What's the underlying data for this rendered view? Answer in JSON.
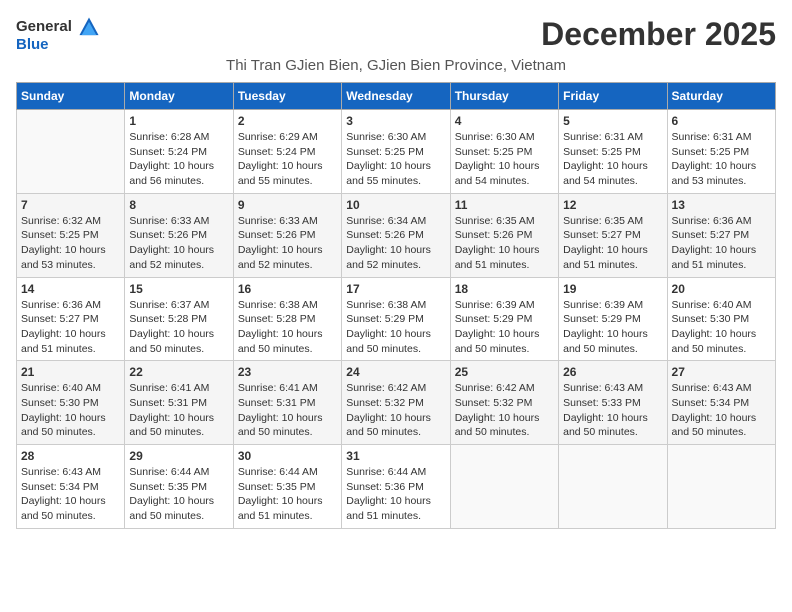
{
  "header": {
    "logo_general": "General",
    "logo_blue": "Blue",
    "month_title": "December 2025",
    "location": "Thi Tran GJien Bien, GJien Bien Province, Vietnam"
  },
  "days_of_week": [
    "Sunday",
    "Monday",
    "Tuesday",
    "Wednesday",
    "Thursday",
    "Friday",
    "Saturday"
  ],
  "weeks": [
    [
      {
        "day": "",
        "info": ""
      },
      {
        "day": "1",
        "info": "Sunrise: 6:28 AM\nSunset: 5:24 PM\nDaylight: 10 hours\nand 56 minutes."
      },
      {
        "day": "2",
        "info": "Sunrise: 6:29 AM\nSunset: 5:24 PM\nDaylight: 10 hours\nand 55 minutes."
      },
      {
        "day": "3",
        "info": "Sunrise: 6:30 AM\nSunset: 5:25 PM\nDaylight: 10 hours\nand 55 minutes."
      },
      {
        "day": "4",
        "info": "Sunrise: 6:30 AM\nSunset: 5:25 PM\nDaylight: 10 hours\nand 54 minutes."
      },
      {
        "day": "5",
        "info": "Sunrise: 6:31 AM\nSunset: 5:25 PM\nDaylight: 10 hours\nand 54 minutes."
      },
      {
        "day": "6",
        "info": "Sunrise: 6:31 AM\nSunset: 5:25 PM\nDaylight: 10 hours\nand 53 minutes."
      }
    ],
    [
      {
        "day": "7",
        "info": "Sunrise: 6:32 AM\nSunset: 5:25 PM\nDaylight: 10 hours\nand 53 minutes."
      },
      {
        "day": "8",
        "info": "Sunrise: 6:33 AM\nSunset: 5:26 PM\nDaylight: 10 hours\nand 52 minutes."
      },
      {
        "day": "9",
        "info": "Sunrise: 6:33 AM\nSunset: 5:26 PM\nDaylight: 10 hours\nand 52 minutes."
      },
      {
        "day": "10",
        "info": "Sunrise: 6:34 AM\nSunset: 5:26 PM\nDaylight: 10 hours\nand 52 minutes."
      },
      {
        "day": "11",
        "info": "Sunrise: 6:35 AM\nSunset: 5:26 PM\nDaylight: 10 hours\nand 51 minutes."
      },
      {
        "day": "12",
        "info": "Sunrise: 6:35 AM\nSunset: 5:27 PM\nDaylight: 10 hours\nand 51 minutes."
      },
      {
        "day": "13",
        "info": "Sunrise: 6:36 AM\nSunset: 5:27 PM\nDaylight: 10 hours\nand 51 minutes."
      }
    ],
    [
      {
        "day": "14",
        "info": "Sunrise: 6:36 AM\nSunset: 5:27 PM\nDaylight: 10 hours\nand 51 minutes."
      },
      {
        "day": "15",
        "info": "Sunrise: 6:37 AM\nSunset: 5:28 PM\nDaylight: 10 hours\nand 50 minutes."
      },
      {
        "day": "16",
        "info": "Sunrise: 6:38 AM\nSunset: 5:28 PM\nDaylight: 10 hours\nand 50 minutes."
      },
      {
        "day": "17",
        "info": "Sunrise: 6:38 AM\nSunset: 5:29 PM\nDaylight: 10 hours\nand 50 minutes."
      },
      {
        "day": "18",
        "info": "Sunrise: 6:39 AM\nSunset: 5:29 PM\nDaylight: 10 hours\nand 50 minutes."
      },
      {
        "day": "19",
        "info": "Sunrise: 6:39 AM\nSunset: 5:29 PM\nDaylight: 10 hours\nand 50 minutes."
      },
      {
        "day": "20",
        "info": "Sunrise: 6:40 AM\nSunset: 5:30 PM\nDaylight: 10 hours\nand 50 minutes."
      }
    ],
    [
      {
        "day": "21",
        "info": "Sunrise: 6:40 AM\nSunset: 5:30 PM\nDaylight: 10 hours\nand 50 minutes."
      },
      {
        "day": "22",
        "info": "Sunrise: 6:41 AM\nSunset: 5:31 PM\nDaylight: 10 hours\nand 50 minutes."
      },
      {
        "day": "23",
        "info": "Sunrise: 6:41 AM\nSunset: 5:31 PM\nDaylight: 10 hours\nand 50 minutes."
      },
      {
        "day": "24",
        "info": "Sunrise: 6:42 AM\nSunset: 5:32 PM\nDaylight: 10 hours\nand 50 minutes."
      },
      {
        "day": "25",
        "info": "Sunrise: 6:42 AM\nSunset: 5:32 PM\nDaylight: 10 hours\nand 50 minutes."
      },
      {
        "day": "26",
        "info": "Sunrise: 6:43 AM\nSunset: 5:33 PM\nDaylight: 10 hours\nand 50 minutes."
      },
      {
        "day": "27",
        "info": "Sunrise: 6:43 AM\nSunset: 5:34 PM\nDaylight: 10 hours\nand 50 minutes."
      }
    ],
    [
      {
        "day": "28",
        "info": "Sunrise: 6:43 AM\nSunset: 5:34 PM\nDaylight: 10 hours\nand 50 minutes."
      },
      {
        "day": "29",
        "info": "Sunrise: 6:44 AM\nSunset: 5:35 PM\nDaylight: 10 hours\nand 50 minutes."
      },
      {
        "day": "30",
        "info": "Sunrise: 6:44 AM\nSunset: 5:35 PM\nDaylight: 10 hours\nand 51 minutes."
      },
      {
        "day": "31",
        "info": "Sunrise: 6:44 AM\nSunset: 5:36 PM\nDaylight: 10 hours\nand 51 minutes."
      },
      {
        "day": "",
        "info": ""
      },
      {
        "day": "",
        "info": ""
      },
      {
        "day": "",
        "info": ""
      }
    ]
  ]
}
